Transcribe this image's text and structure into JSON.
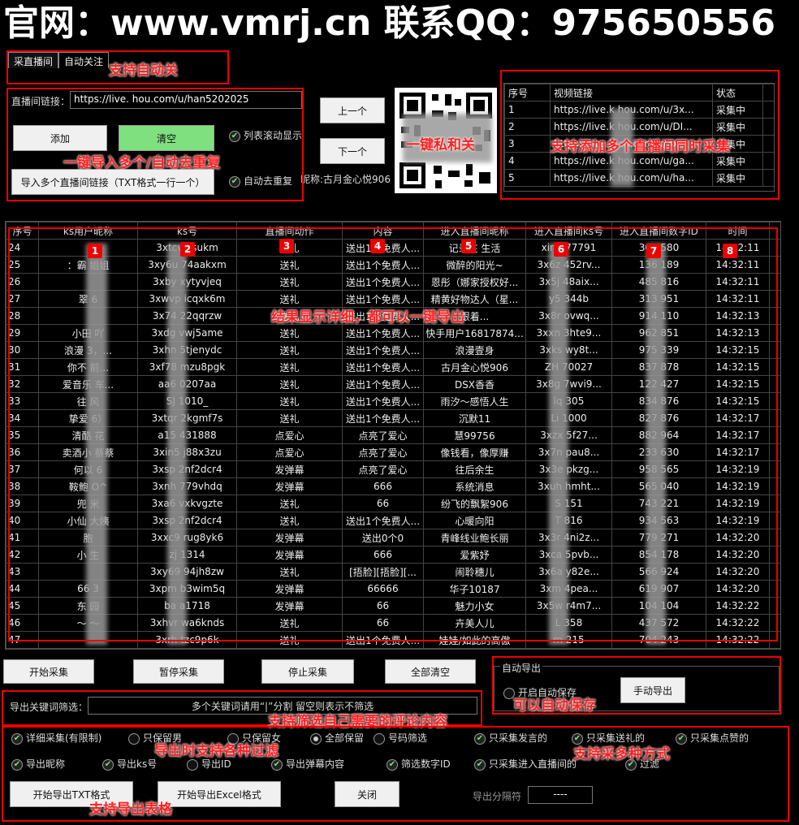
{
  "banner": "官网：www.vmrj.cn 联系QQ：975650556",
  "tabs": [
    "采直播间",
    "自动关注"
  ],
  "notes": {
    "auto_follow": "支持自动关",
    "import_dedupe": "一键导入多个/自动去重复",
    "one_click_dm": "一键私和关",
    "multi_rooms": "支持添加多个直播间同时采集",
    "results": "结果显示详细，都可以一键导出",
    "auto_save": "可以自动保存",
    "filter": "支持筛选自己需要的评论内容",
    "export_filters": "导出时支持各种过滤",
    "collect_modes": "支持采多种方式",
    "export_table": "支持导出表格"
  },
  "room": {
    "link_label": "直播间链接：",
    "link_value": "https://live.       hou.com/u/han5202025",
    "add": "添加",
    "clear": "清空",
    "scroll_show": "列表滚动显示",
    "import": "导入多个直播间链接（TXT格式一行一个）",
    "auto_dedupe": "自动去重复",
    "prev": "上一个",
    "next": "下一个",
    "nickname": "昵称:古月金心悦906"
  },
  "room_list": {
    "headers": [
      "序号",
      "视频链接",
      "状态"
    ],
    "rows": [
      [
        "1",
        "https://live.k      hou.com/u/3x...",
        "采集中"
      ],
      [
        "2",
        "https://live.k      hou.com/u/DI...",
        "采集中"
      ],
      [
        "3",
        "https://live.k      ou.com/u/3x...",
        "采集中"
      ],
      [
        "4",
        "https://live.k      hou.com/u/ga...",
        "采集中"
      ],
      [
        "5",
        "https://live.k      hou.com/u/ha...",
        "采集中"
      ]
    ]
  },
  "results": {
    "headers": [
      "序号",
      "ks用户昵称",
      "ks号",
      "直播间动作",
      "内容",
      "进入直播间昵称",
      "进入直播间ks号",
      "进入直播间数字ID",
      "时间"
    ],
    "badges": [
      "1",
      "2",
      "3",
      "4",
      "5",
      "6",
      "7",
      "8"
    ],
    "rows": [
      [
        "24",
        "",
        "3xtcv     ysukm",
        "送礼",
        "送出1个免费人...",
        "记录在    生活",
        "xin2    77791",
        "302     580",
        "14:32:11"
      ],
      [
        "25",
        "：霸    姐姐",
        "3xy6u    74aakxm",
        "送礼",
        "送出1个免费人...",
        "微醉的阳光~",
        "3x6z    452rv...",
        "136     189",
        "14:32:11"
      ],
      [
        "26",
        "",
        "3xby    xytyvjeq",
        "送礼",
        "送出1个免费人...",
        "恩彤（娜家授权好...",
        "3x5j    48aix...",
        "485     816",
        "14:32:11"
      ],
      [
        "27",
        "翠    6",
        "3xwvp    icqxk6m",
        "送礼",
        "送出1个免费人...",
        "精黄好物达人（星...",
        "y5    344b",
        "313     951",
        "14:32:11"
      ],
      [
        "28",
        "",
        "3x74    22qqrzw",
        "送礼",
        "送出1个免费人...",
        "跟着...",
        "3x8r    ovwq...",
        "914     110",
        "14:32:13"
      ],
      [
        "29",
        "小田    吖",
        "3xdg    vwj5ame",
        "送礼",
        "送出1个免费人...",
        "快手用户16817874...",
        "3xxn    3hte9...",
        "962     851",
        "14:32:13"
      ],
      [
        "30",
        "浪漫    3，...",
        "3xhn    5tjenydc",
        "送礼",
        "送出1个免费人...",
        "浪漫壹身",
        "3xks    wy8t...",
        "975     339",
        "14:32:15"
      ],
      [
        "31",
        "你不    前...",
        "3xf78    mzu8pgk",
        "送礼",
        "送出1个免费人...",
        "古月金心悦906",
        "ZH    70027",
        "837     878",
        "14:32:15"
      ],
      [
        "32",
        "爱音乐    车...",
        "aa6    0207aa",
        "送礼",
        "送出1个免费人...",
        "DSX香香",
        "3x8g    7wvi9...",
        "122     427",
        "14:32:15"
      ],
      [
        "33",
        "往    风",
        "SJ    1010_",
        "送礼",
        "送出1个免费人...",
        "雨汐～感悟人生",
        "lq    305",
        "834     876",
        "14:32:15"
      ],
      [
        "34",
        "挚爱    6）",
        "3xtqr    2kgmf7s",
        "送礼",
        "送出1个免费人...",
        "沉默11",
        "Li    1000",
        "827     876",
        "14:32:17"
      ],
      [
        "35",
        "清酷    花",
        "a15    431888",
        "点爱心",
        "点亮了爱心",
        "慧99756",
        "3xzx    5f27...",
        "882     964",
        "14:32:17"
      ],
      [
        "36",
        "卖酒小    蔡蔡",
        "3xin5    j88x3zu",
        "点爱心",
        "点亮了爱心",
        "像钱看，像厚赚",
        "3x7n    pau8...",
        "233     630",
        "14:32:17"
      ],
      [
        "37",
        "何以    6",
        "3xsp    2nf2dcr4",
        "发弹幕",
        "点亮了爱心",
        "往后余生",
        "3x3e    pkzg...",
        "958     565",
        "14:32:19"
      ],
      [
        "38",
        "鞍鲍    O^",
        "3xnh    779vhdq",
        "发弹幕",
        "666",
        "系统消息",
        "3xuh    hmht...",
        "565     040",
        "14:32:19"
      ],
      [
        "39",
        "兜    米",
        "3xa6    vxkvgzte",
        "送礼",
        "66",
        "纷飞的飘絮906",
        "S    151",
        "743     221",
        "14:32:19"
      ],
      [
        "40",
        "小仙    大姨",
        "3xsp    2nf2dcr4",
        "送礼",
        "送出1个免费人...",
        "心暖向阳",
        "T    816",
        "934     563",
        "14:32:19"
      ],
      [
        "41",
        "胞    ",
        "3xxc9    rug8yk6",
        "发弹幕",
        "送出0个0",
        "青峰线业鲍长丽",
        "3x3r    4ni2z...",
        "779     271",
        "14:32:20"
      ],
      [
        "42",
        "小    生",
        "zj    1314",
        "发弹幕",
        "666",
        "爱紫妤",
        "3xca    5pvb...",
        "854     178",
        "14:32:20"
      ],
      [
        "43",
        "",
        "3xy69    94jh8zw",
        "送礼",
        "[捂脸][捂脸][...",
        "闹聆穗儿",
        "3x6a    y82e...",
        "566     924",
        "14:32:20"
      ],
      [
        "44",
        "66    3",
        "3xpm    b3wim5q",
        "发弹幕",
        "66666",
        "华子10187",
        "3xm    4pea...",
        "619     907",
        "14:32:20"
      ],
      [
        "45",
        "东    园",
        "ba    a1718",
        "发弹幕",
        "66",
        "魅力小女",
        "3x5w    r4m7...",
        "104     104",
        "14:32:22"
      ],
      [
        "46",
        "～    ～",
        "3xhvr    wa6knds",
        "送礼",
        "66",
        "卉美人儿",
        "L    358",
        "437     572",
        "14:32:22"
      ],
      [
        "47",
        "",
        "3xrh    tzc9p6k",
        "送礼",
        "送出1个免费人...",
        "娃娃/如此的高傲",
        "m    215",
        "704     243",
        "14:32:22"
      ]
    ]
  },
  "controls": {
    "start": "开始采集",
    "pause": "暂停采集",
    "stop": "停止采集",
    "clear_all": "全部清空",
    "auto_export_title": "自动导出",
    "auto_save": "开启自动保存",
    "manual_export": "手动导出"
  },
  "filter": {
    "label": "导出关键词筛选：",
    "placeholder": "多个关键词请用“|”分割 留空则表示不筛选"
  },
  "options_row1": [
    "详细采集(有限制)",
    "只保留男",
    "只保留女",
    "全部保留",
    "号码筛选",
    "只采集发言的",
    "只采集送礼的",
    "只采集点赞的"
  ],
  "options_row2": [
    "导出昵称",
    "导出ks号",
    "导出ID",
    "导出弹幕内容",
    "筛选数字ID",
    "只采集进入直播间的",
    "过滤"
  ],
  "export": {
    "txt": "开始导出TXT格式",
    "excel": "开始导出Excel格式",
    "close": "关闭",
    "sep_label": "导出分隔符",
    "sep_value": "----"
  }
}
